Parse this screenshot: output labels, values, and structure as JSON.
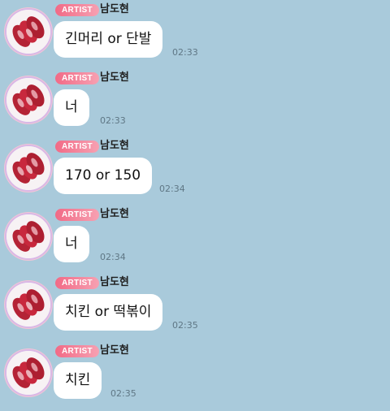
{
  "theme": {
    "background": "#a9cadb",
    "bubble": "#ffffff",
    "badge_start": "#f26a86",
    "badge_end": "#f6a1b2"
  },
  "messages": [
    {
      "badge": "ARTIST",
      "sender": "남도현",
      "avatar_icon": "meat-icon",
      "text": "긴머리 or 단발",
      "time": "02:33"
    },
    {
      "badge": "ARTIST",
      "sender": "남도현",
      "avatar_icon": "meat-icon",
      "text": "너",
      "time": "02:33"
    },
    {
      "badge": "ARTIST",
      "sender": "남도현",
      "avatar_icon": "meat-icon",
      "text": "170 or 150",
      "time": "02:34"
    },
    {
      "badge": "ARTIST",
      "sender": "남도현",
      "avatar_icon": "meat-icon",
      "text": "너",
      "time": "02:34"
    },
    {
      "badge": "ARTIST",
      "sender": "남도현",
      "avatar_icon": "meat-icon",
      "text": "치킨 or 떡볶이",
      "time": "02:35"
    },
    {
      "badge": "ARTIST",
      "sender": "남도현",
      "avatar_icon": "meat-icon",
      "text": "치킨",
      "time": "02:35"
    }
  ]
}
